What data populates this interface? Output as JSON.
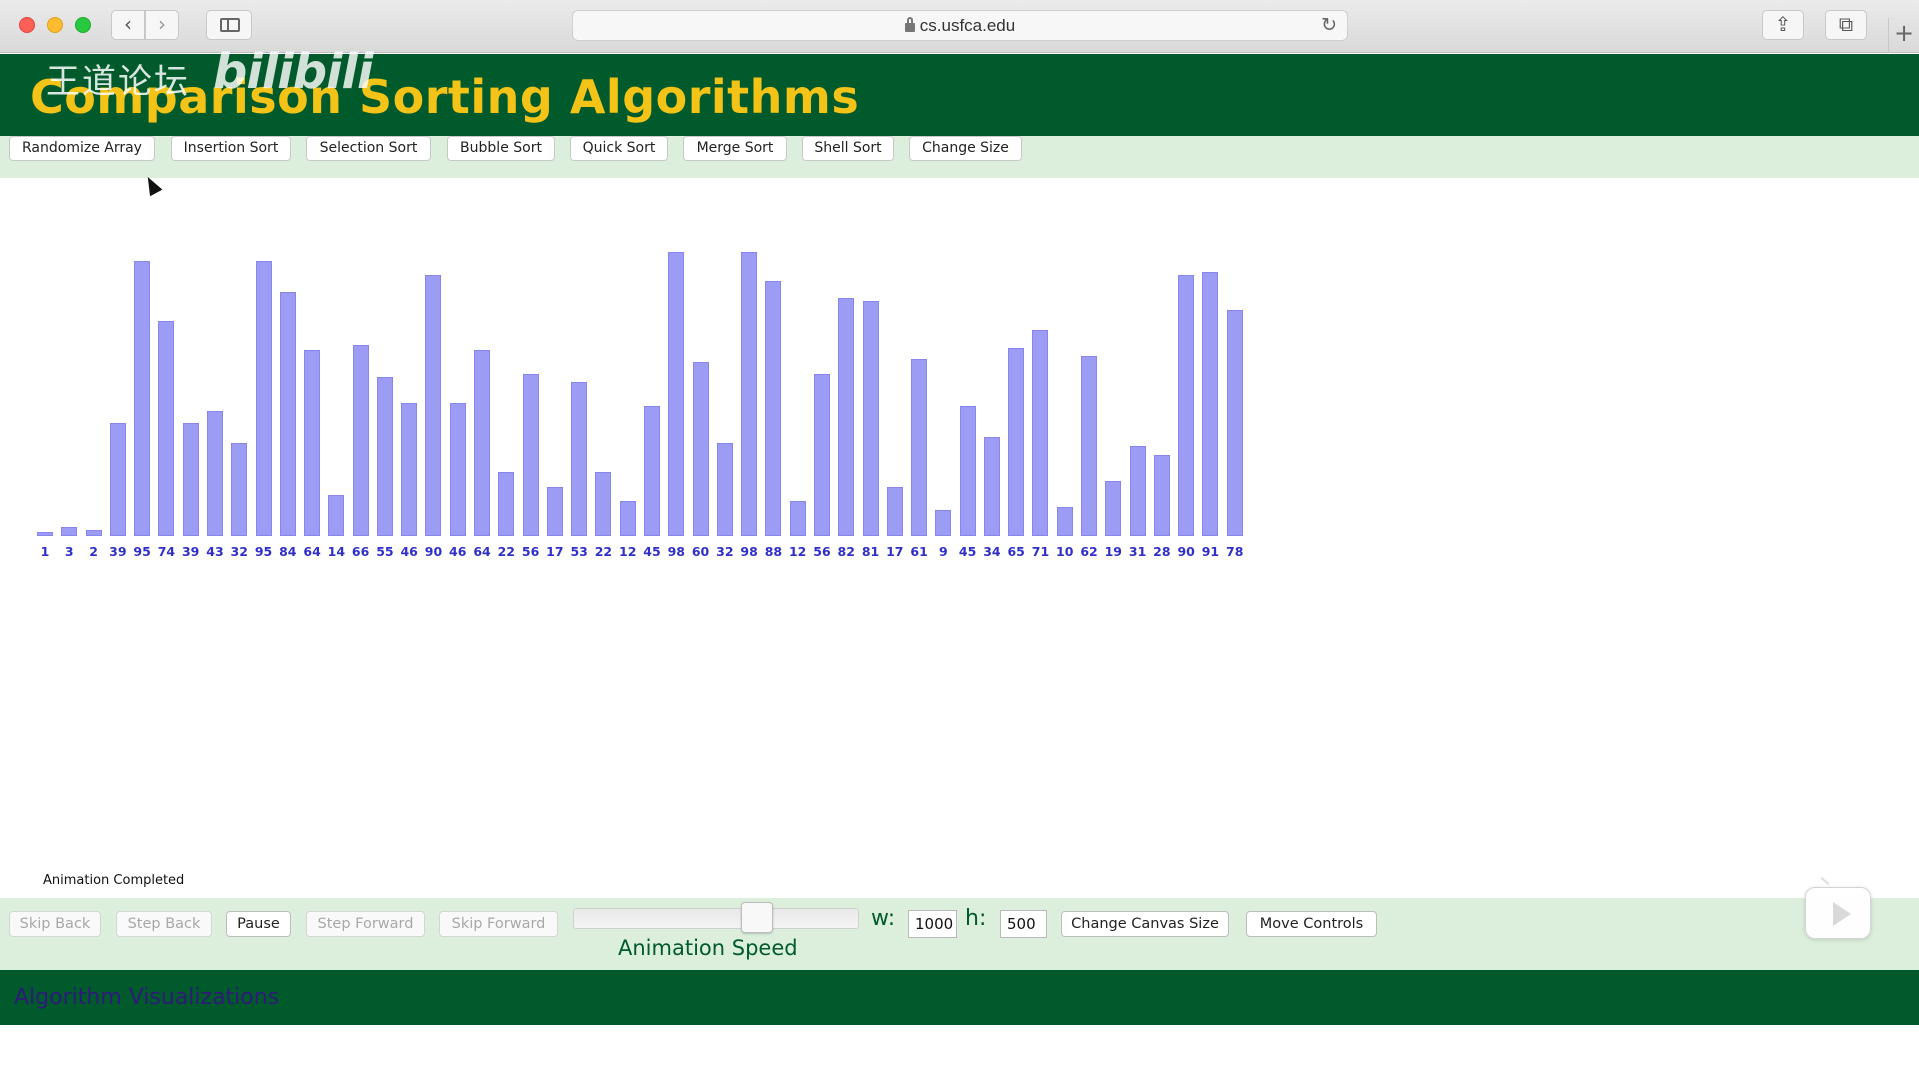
{
  "browser": {
    "url": "cs.usfca.edu"
  },
  "header": {
    "title": "Comparison Sorting Algorithms",
    "watermark_text": "王道论坛",
    "watermark_logo": "bilibili"
  },
  "toolbar": {
    "buttons": [
      "Randomize Array",
      "Insertion Sort",
      "Selection Sort",
      "Bubble Sort",
      "Quick Sort",
      "Merge Sort",
      "Shell Sort",
      "Change Size"
    ]
  },
  "chart_data": {
    "type": "bar",
    "categories": [
      "1",
      "3",
      "2",
      "39",
      "95",
      "74",
      "39",
      "43",
      "32",
      "95",
      "84",
      "64",
      "14",
      "66",
      "55",
      "46",
      "90",
      "46",
      "64",
      "22",
      "56",
      "17",
      "53",
      "22",
      "12",
      "45",
      "98",
      "60",
      "32",
      "98",
      "88",
      "12",
      "56",
      "82",
      "81",
      "17",
      "61",
      "9",
      "45",
      "34",
      "65",
      "71",
      "10",
      "62",
      "19",
      "31",
      "28",
      "90",
      "91",
      "78"
    ],
    "values": [
      1,
      3,
      2,
      39,
      95,
      74,
      39,
      43,
      32,
      95,
      84,
      64,
      14,
      66,
      55,
      46,
      90,
      46,
      64,
      22,
      56,
      17,
      53,
      22,
      12,
      45,
      98,
      60,
      32,
      98,
      88,
      12,
      56,
      82,
      81,
      17,
      61,
      9,
      45,
      34,
      65,
      71,
      10,
      62,
      19,
      31,
      28,
      90,
      91,
      78
    ],
    "bar_color": "#9c9cf5",
    "label_color": "#3030c8"
  },
  "status": {
    "text": "Animation Completed"
  },
  "controls": {
    "skip_back": "Skip Back",
    "step_back": "Step Back",
    "pause": "Pause",
    "step_forward": "Step Forward",
    "skip_forward": "Skip Forward",
    "speed_label": "Animation Speed",
    "width_label": "w:",
    "width_value": "1000",
    "height_label": "h:",
    "height_value": "500",
    "change_canvas": "Change Canvas Size",
    "move_controls": "Move Controls"
  },
  "footer": {
    "text": "Algorithm Visualizations"
  },
  "colors": {
    "header_green": "#005a2b",
    "title_yellow": "#f3c317",
    "toolbar_bg": "#dcefdc"
  }
}
